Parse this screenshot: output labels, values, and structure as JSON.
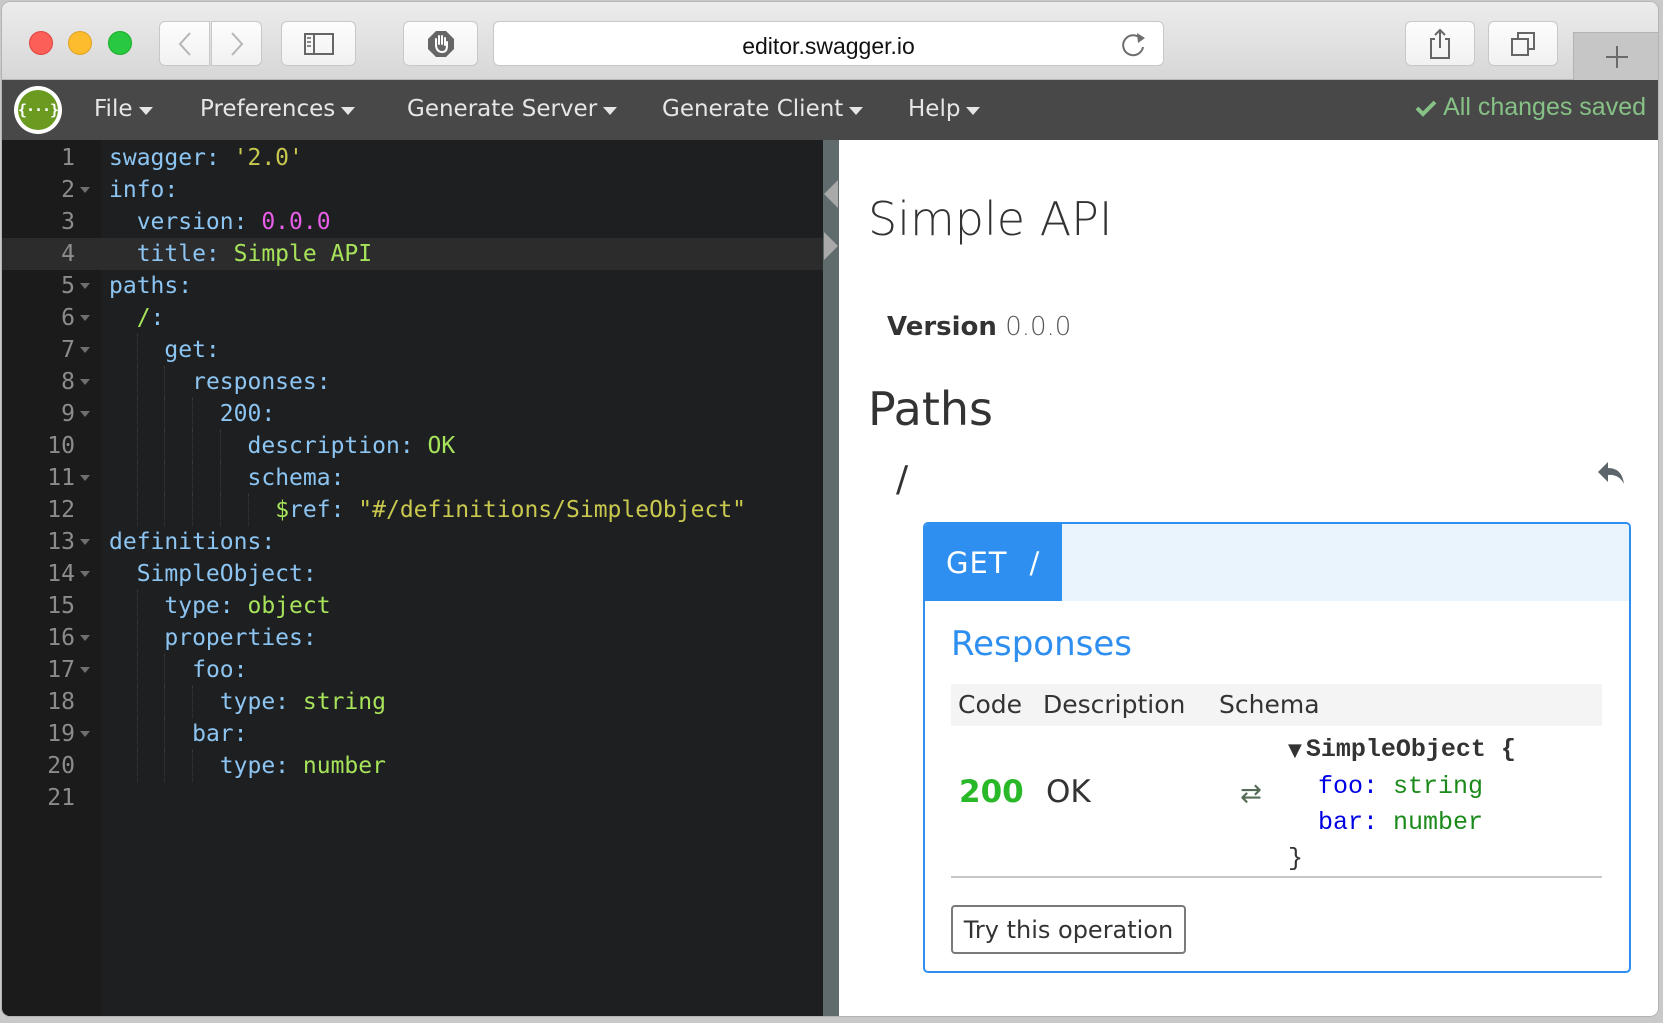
{
  "browser": {
    "url": "editor.swagger.io",
    "buttons": {
      "back": "chevron-left-icon",
      "forward": "chevron-right-icon",
      "sidebar": "sidebar-icon",
      "block": "hand-stop-icon",
      "reload": "reload-icon",
      "share": "share-icon",
      "tabs": "tabs-icon",
      "new_tab": "plus-icon"
    }
  },
  "navbar": {
    "logo": "{···}",
    "menus": [
      {
        "label": "File"
      },
      {
        "label": "Preferences"
      },
      {
        "label": "Generate Server"
      },
      {
        "label": "Generate Client"
      },
      {
        "label": "Help"
      }
    ],
    "status": "All changes saved",
    "status_color": "#86c186"
  },
  "editor": {
    "active_line": 4,
    "lines": [
      {
        "n": "1",
        "fold": false,
        "indent": 0,
        "tokens": [
          {
            "t": "swagger: ",
            "c": "k"
          },
          {
            "t": "'2.0'",
            "c": "s"
          }
        ]
      },
      {
        "n": "2",
        "fold": true,
        "indent": 0,
        "tokens": [
          {
            "t": "info:",
            "c": "k"
          }
        ]
      },
      {
        "n": "3",
        "fold": false,
        "indent": 1,
        "tokens": [
          {
            "t": "version: ",
            "c": "k"
          },
          {
            "t": "0.0.0",
            "c": "n"
          }
        ]
      },
      {
        "n": "4",
        "fold": false,
        "indent": 1,
        "tokens": [
          {
            "t": "title: ",
            "c": "k"
          },
          {
            "t": "Simple API",
            "c": "v"
          }
        ]
      },
      {
        "n": "5",
        "fold": true,
        "indent": 0,
        "tokens": [
          {
            "t": "paths:",
            "c": "k"
          }
        ]
      },
      {
        "n": "6",
        "fold": true,
        "indent": 1,
        "tokens": [
          {
            "t": "/",
            "c": "v"
          },
          {
            "t": ":",
            "c": "k"
          }
        ]
      },
      {
        "n": "7",
        "fold": true,
        "indent": 2,
        "tokens": [
          {
            "t": "get:",
            "c": "k"
          }
        ]
      },
      {
        "n": "8",
        "fold": true,
        "indent": 3,
        "tokens": [
          {
            "t": "responses:",
            "c": "k"
          }
        ]
      },
      {
        "n": "9",
        "fold": true,
        "indent": 4,
        "tokens": [
          {
            "t": "200:",
            "c": "k"
          }
        ]
      },
      {
        "n": "10",
        "fold": false,
        "indent": 5,
        "tokens": [
          {
            "t": "description: ",
            "c": "k"
          },
          {
            "t": "OK",
            "c": "v"
          }
        ]
      },
      {
        "n": "11",
        "fold": true,
        "indent": 5,
        "tokens": [
          {
            "t": "schema:",
            "c": "k"
          }
        ]
      },
      {
        "n": "12",
        "fold": false,
        "indent": 6,
        "tokens": [
          {
            "t": "$",
            "c": "v"
          },
          {
            "t": "ref: ",
            "c": "k"
          },
          {
            "t": "\"#/definitions/SimpleObject\"",
            "c": "s"
          }
        ]
      },
      {
        "n": "13",
        "fold": true,
        "indent": 0,
        "tokens": [
          {
            "t": "definitions:",
            "c": "k"
          }
        ]
      },
      {
        "n": "14",
        "fold": true,
        "indent": 1,
        "tokens": [
          {
            "t": "SimpleObject:",
            "c": "k"
          }
        ]
      },
      {
        "n": "15",
        "fold": false,
        "indent": 2,
        "tokens": [
          {
            "t": "type: ",
            "c": "k"
          },
          {
            "t": "object",
            "c": "v"
          }
        ]
      },
      {
        "n": "16",
        "fold": true,
        "indent": 2,
        "tokens": [
          {
            "t": "properties:",
            "c": "k"
          }
        ]
      },
      {
        "n": "17",
        "fold": true,
        "indent": 3,
        "tokens": [
          {
            "t": "foo:",
            "c": "k"
          }
        ]
      },
      {
        "n": "18",
        "fold": false,
        "indent": 4,
        "tokens": [
          {
            "t": "type: ",
            "c": "k"
          },
          {
            "t": "string",
            "c": "v"
          }
        ]
      },
      {
        "n": "19",
        "fold": true,
        "indent": 3,
        "tokens": [
          {
            "t": "bar:",
            "c": "k"
          }
        ]
      },
      {
        "n": "20",
        "fold": false,
        "indent": 4,
        "tokens": [
          {
            "t": "type: ",
            "c": "k"
          },
          {
            "t": "number",
            "c": "v"
          }
        ]
      },
      {
        "n": "21",
        "fold": false,
        "indent": 0,
        "tokens": []
      }
    ]
  },
  "preview": {
    "title": "Simple API",
    "version_label": "Version",
    "version_value": "0.0.0",
    "paths_heading": "Paths",
    "path": "/",
    "jump_icon": "reply-icon",
    "operation": {
      "method": "GET",
      "path": "/",
      "method_color": "#2f8ff0",
      "responses_heading": "Responses",
      "columns": [
        "Code",
        "Description",
        "Schema"
      ],
      "responses": [
        {
          "code": "200",
          "description": "OK",
          "schema_toggle": "⇄",
          "model_name": "SimpleObject",
          "open_brace": "{",
          "close_brace": "}",
          "properties": [
            {
              "name": "foo:",
              "type": "string"
            },
            {
              "name": "bar:",
              "type": "number"
            }
          ]
        }
      ],
      "try_button": "Try this operation"
    }
  }
}
